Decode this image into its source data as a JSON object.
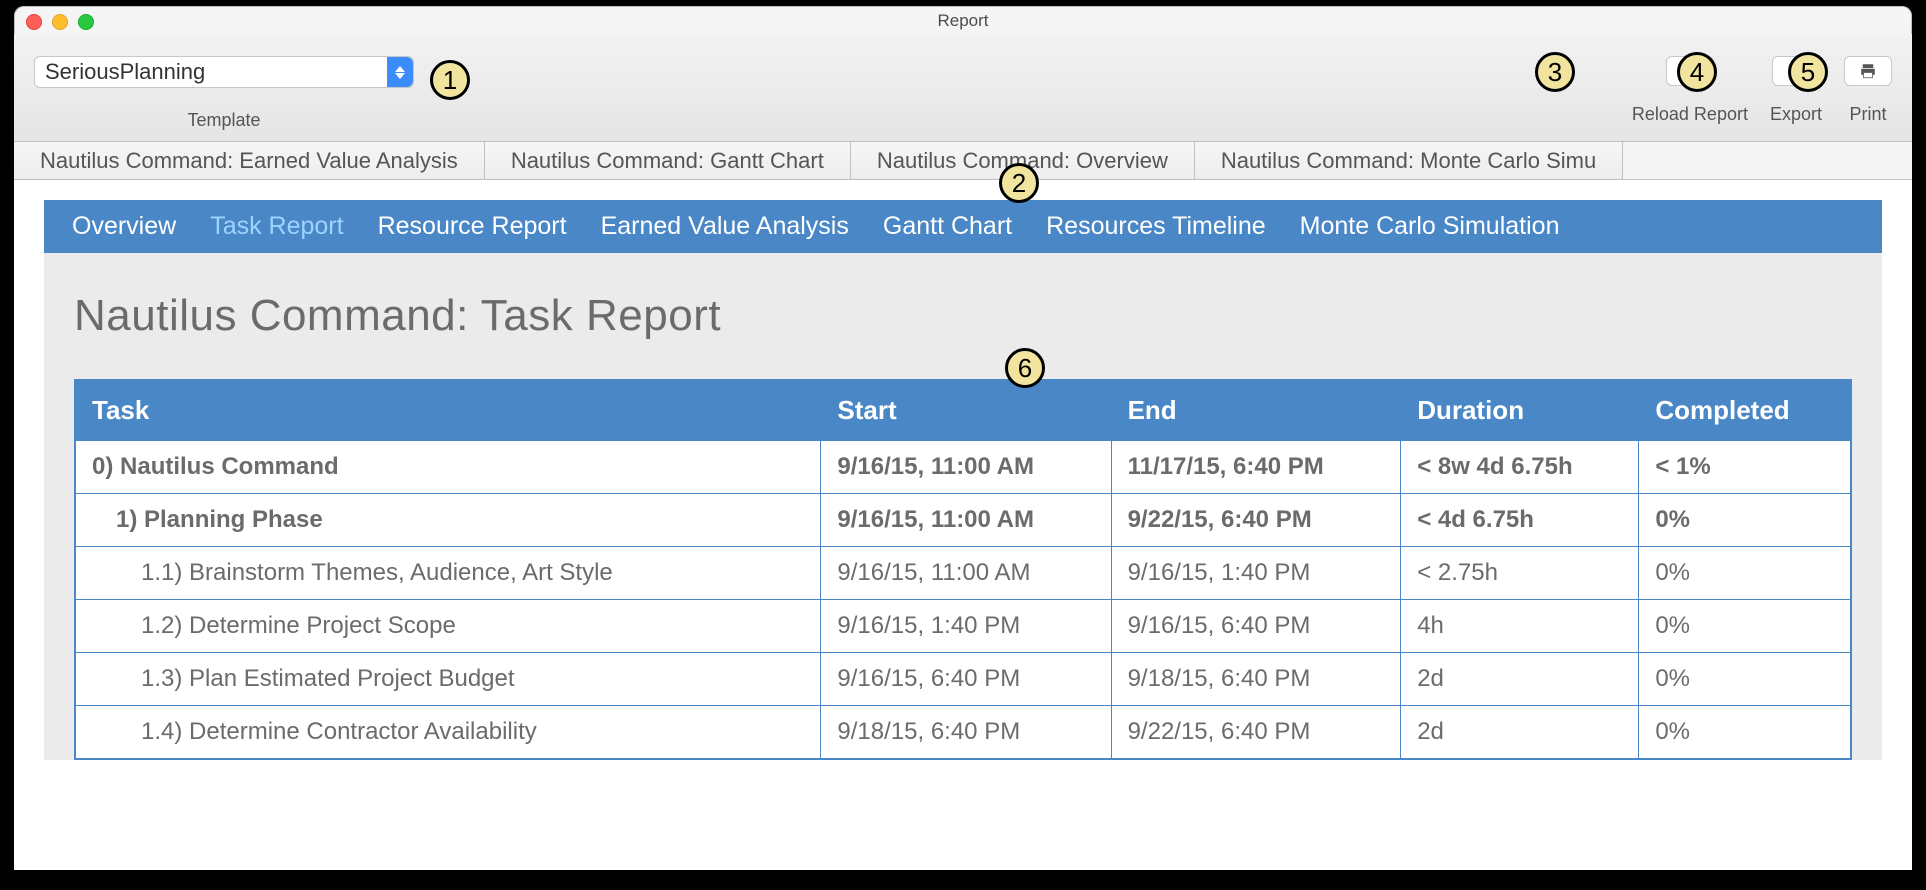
{
  "window": {
    "title": "Report"
  },
  "toolbar": {
    "template_value": "SeriousPlanning",
    "template_label": "Template",
    "reload_label": "Reload Report",
    "export_label": "Export",
    "print_label": "Print"
  },
  "tabs": [
    "Nautilus Command: Earned Value Analysis",
    "Nautilus Command: Gantt Chart",
    "Nautilus Command: Overview",
    "Nautilus Command: Monte Carlo Simu"
  ],
  "inner_nav": {
    "items": [
      {
        "label": "Overview",
        "active": false
      },
      {
        "label": "Task Report",
        "active": true
      },
      {
        "label": "Resource Report",
        "active": false
      },
      {
        "label": "Earned Value Analysis",
        "active": false
      },
      {
        "label": "Gantt Chart",
        "active": false
      },
      {
        "label": "Resources Timeline",
        "active": false
      },
      {
        "label": "Monte Carlo Simulation",
        "active": false
      }
    ]
  },
  "report": {
    "title_prefix": "Nautilus Command:",
    "title_suffix": " Task Report",
    "columns": [
      "Task",
      "Start",
      "End",
      "Duration",
      "Completed"
    ],
    "rows": [
      {
        "task": "0) Nautilus Command",
        "start": "9/16/15, 11:00 AM",
        "end": "11/17/15, 6:40 PM",
        "duration": "< 8w 4d 6.75h",
        "completed": "< 1%",
        "bold": true,
        "indent": 0
      },
      {
        "task": "1) Planning Phase",
        "start": "9/16/15, 11:00 AM",
        "end": "9/22/15, 6:40 PM",
        "duration": "< 4d 6.75h",
        "completed": "0%",
        "bold": true,
        "indent": 1
      },
      {
        "task": "1.1) Brainstorm Themes, Audience, Art Style",
        "start": "9/16/15, 11:00 AM",
        "end": "9/16/15, 1:40 PM",
        "duration": "< 2.75h",
        "completed": "0%",
        "bold": false,
        "indent": 2
      },
      {
        "task": "1.2) Determine Project Scope",
        "start": "9/16/15, 1:40 PM",
        "end": "9/16/15, 6:40 PM",
        "duration": "4h",
        "completed": "0%",
        "bold": false,
        "indent": 2
      },
      {
        "task": "1.3) Plan Estimated Project Budget",
        "start": "9/16/15, 6:40 PM",
        "end": "9/18/15, 6:40 PM",
        "duration": "2d",
        "completed": "0%",
        "bold": false,
        "indent": 2
      },
      {
        "task": "1.4) Determine Contractor Availability",
        "start": "9/18/15, 6:40 PM",
        "end": "9/22/15, 6:40 PM",
        "duration": "2d",
        "completed": "0%",
        "bold": false,
        "indent": 2
      }
    ]
  },
  "annotations": {
    "1": "1",
    "2": "2",
    "3": "3",
    "4": "4",
    "5": "5",
    "6": "6"
  }
}
